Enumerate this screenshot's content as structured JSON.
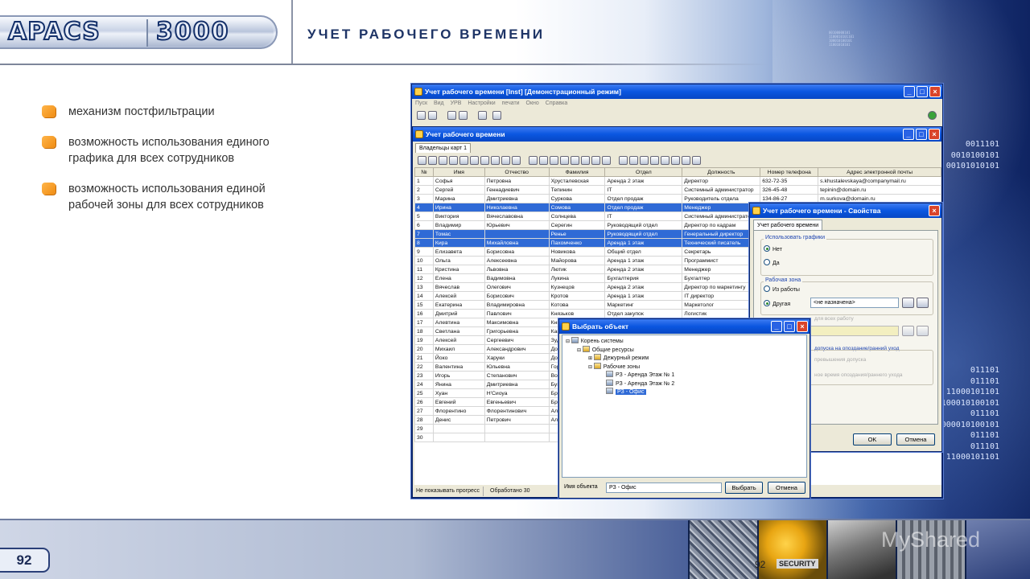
{
  "logo": {
    "left": "APACS",
    "right": "3000"
  },
  "header": {
    "title": "УЧЕТ РАБОЧЕГО ВРЕМЕНИ"
  },
  "bullets": [
    "механизм постфильтрации",
    "возможность использования единого графика для всех сотрудников",
    "возможность использования единой рабочей зоны для всех сотрудников"
  ],
  "binary": {
    "lines": [
      "00100000101",
      "1100010101101",
      "100010100101",
      "11001010101"
    ],
    "lines2": [
      "011101",
      "0011101",
      "0010100101",
      "00101010101",
      "011101",
      "11000101101",
      "1100010100101",
      "011101",
      "1000010100101",
      "011101"
    ]
  },
  "footer": {
    "page_number": "92",
    "page_number_small": "92",
    "watermark": "MyShared",
    "thumb_sign": "SECURITY"
  },
  "screenshot": {
    "main_window": {
      "title": "Учет рабочего времени [Inst] [Демонстрационный режим]",
      "menu": [
        "Пуск",
        "Вид",
        "УРВ",
        "Настройки печати",
        "Окно",
        "Справка"
      ]
    },
    "child_window": {
      "title": "Учет рабочего времени",
      "tab": "Владельцы карт 1",
      "columns": [
        "№",
        "Имя",
        "Отчество",
        "Фамилия",
        "Отдел",
        "Должность",
        "Номер телефона",
        "Адрес электронной почты"
      ],
      "rows": [
        [
          "1",
          "Софья",
          "Петровна",
          "Хрусталевская",
          "Аренда 2 этаж",
          "Директор",
          "632-72-35",
          "s.khustalevskaya@companymail.ru"
        ],
        [
          "2",
          "Сергей",
          "Геннадиевич",
          "Тепинин",
          "IT",
          "Системный администратор",
          "326-45-48",
          "tepinin@domain.ru"
        ],
        [
          "3",
          "Марина",
          "Дмитриевна",
          "Суркова",
          "Отдел продаж",
          "Руководитель отдела",
          "134-86-27",
          "m.surkova@domain.ru"
        ],
        [
          "4",
          "Ирина",
          "Николаевна",
          "Сомова",
          "Отдел продаж",
          "Менеджер",
          "",
          ""
        ],
        [
          "5",
          "Виктория",
          "Вячеславовна",
          "Солнцева",
          "IT",
          "Системный администратор",
          "",
          ""
        ],
        [
          "6",
          "Владимир",
          "Юрьевич",
          "Серегин",
          "Руководящий отдел",
          "Директор по кадрам",
          "",
          ""
        ],
        [
          "7",
          "Томас",
          "",
          "Ренье",
          "Руководящий отдел",
          "Генеральный директор",
          "",
          ""
        ],
        [
          "8",
          "Кира",
          "Михайловна",
          "Пахомченко",
          "Аренда 1 этаж",
          "Технический писатель",
          "",
          ""
        ],
        [
          "9",
          "Елизавета",
          "Борисовна",
          "Новикова",
          "Общий отдел",
          "Секретарь",
          "",
          ""
        ],
        [
          "10",
          "Ольга",
          "Алексеевна",
          "Майорова",
          "Аренда 1 этаж",
          "Программист",
          "",
          ""
        ],
        [
          "11",
          "Кристина",
          "Львовна",
          "Лютик",
          "Аренда 2 этаж",
          "Менеджер",
          "",
          ""
        ],
        [
          "12",
          "Елена",
          "Вадимовна",
          "Лукина",
          "Бухгалтерия",
          "Бухгалтер",
          "",
          ""
        ],
        [
          "13",
          "Вячеслав",
          "Олегович",
          "Кузнецов",
          "Аренда 2 этаж",
          "Директор по маркетингу",
          "",
          ""
        ],
        [
          "14",
          "Алексей",
          "Борисович",
          "Кротов",
          "Аренда 1 этаж",
          "IT директор",
          "",
          ""
        ],
        [
          "15",
          "Екатерина",
          "Владимировна",
          "Котова",
          "Маркетинг",
          "Маркетолог",
          "",
          ""
        ],
        [
          "16",
          "Дмитрий",
          "Павлович",
          "Князьков",
          "Отдел закупок",
          "Логистик",
          "",
          ""
        ],
        [
          "17",
          "Алевтина",
          "Максимовна",
          "Кни",
          "",
          "",
          "",
          ""
        ],
        [
          "18",
          "Светлана",
          "Григорьевна",
          "Кап",
          "",
          "",
          "",
          ""
        ],
        [
          "19",
          "Алексей",
          "Сергеевич",
          "Зуд",
          "",
          "",
          "",
          ""
        ],
        [
          "20",
          "Михаил",
          "Александрович",
          "Дон",
          "",
          "",
          "",
          ""
        ],
        [
          "21",
          "Йоко",
          "Харуки",
          "Дон",
          "",
          "",
          "",
          ""
        ],
        [
          "22",
          "Валентина",
          "Юльевна",
          "Гор",
          "",
          "",
          "",
          ""
        ],
        [
          "23",
          "Игорь",
          "Степанович",
          "Вор",
          "",
          "",
          "",
          ""
        ],
        [
          "24",
          "Янина",
          "Дмитриевна",
          "Бук",
          "",
          "",
          "",
          ""
        ],
        [
          "25",
          "Хуан",
          "Н'Сиоуа",
          "Бри",
          "",
          "",
          "",
          ""
        ],
        [
          "26",
          "Евгений",
          "Евгеньевич",
          "Бре",
          "",
          "",
          "",
          ""
        ],
        [
          "27",
          "Флорентино",
          "Флорентинович",
          "Але",
          "",
          "",
          "",
          ""
        ],
        [
          "28",
          "Денис",
          "Петрович",
          "Ала",
          "",
          "",
          "",
          ""
        ],
        [
          "29",
          "",
          "",
          "",
          "",
          "",
          "",
          ""
        ],
        [
          "30",
          "",
          "",
          "",
          "",
          "",
          "",
          ""
        ]
      ],
      "selected_rows": [
        4,
        7,
        8
      ],
      "status": [
        "Не показывать прогресс",
        "Обработано 30"
      ]
    },
    "props_dialog": {
      "title": "Учет рабочего времени - Свойства",
      "tab": "Учет рабочего времени",
      "group1": "Использовать графики",
      "opt_no": "Нет",
      "opt_yes": "Да",
      "group2": "Рабочая зона",
      "opt_from_work": "Из работы",
      "opt_other": "Другая",
      "zone_value": "<не назначена>",
      "hidden_text1": "для всех работу",
      "hidden_text2": "допуска на опоздание/ранний уход",
      "hidden_text3": "превышения допуска",
      "hidden_text4": "ное время опоздания/раннего ухода",
      "ok": "OK",
      "cancel": "Отмена"
    },
    "select_dialog": {
      "title": "Выбрать объект",
      "tree": [
        "Корень системы",
        "Общие ресурсы",
        "Дежурный режим",
        "Рабочие зоны",
        "РЗ - Аренда Этаж № 1",
        "РЗ - Аренда Этаж № 2",
        "РЗ - Офис"
      ],
      "name_label": "Имя объекта",
      "name_value": "РЗ - Офис",
      "select_btn": "Выбрать",
      "cancel_btn": "Отмена"
    }
  }
}
